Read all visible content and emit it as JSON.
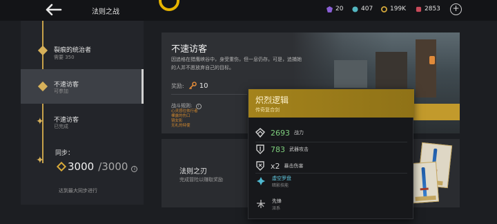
{
  "header": {
    "title": "法则之战",
    "resources": [
      {
        "icon": "purple-gem-icon",
        "value": "20",
        "color": "#8a5fd6"
      },
      {
        "icon": "teal-orb-icon",
        "value": "407",
        "color": "#53b6c0"
      },
      {
        "icon": "gold-coin-icon",
        "value": "199K",
        "color": "#d4a83b"
      },
      {
        "icon": "red-crystal-icon",
        "value": "2853",
        "color": "#c84a5a"
      }
    ]
  },
  "track": {
    "nodes": [
      {
        "title": "裂痕的统治者",
        "sub": "需要 350"
      },
      {
        "title": "不速访客",
        "sub": "可参加"
      },
      {
        "title": "不速访客",
        "sub": "已完成"
      }
    ],
    "sync_label": "同步：",
    "sync_value": "3000",
    "sync_max": "/3000",
    "sync_note": "达到最大同步进行"
  },
  "event": {
    "title": "不速访客",
    "desc": "因追格在猎鹰峡谷中，身受重伤，但一息仍存。可是，追捕她的人并不愿放弃自己的目标。",
    "reward_label": "奖励:",
    "reward_value": "10",
    "rules_label": "战斗规则:",
    "rules": [
      "心灵感往依行者",
      "裸露的伤口",
      "镜女影",
      "无礼的特使"
    ]
  },
  "blade": {
    "title": "法则之刃",
    "sub": "完成冒险以赚取奖励"
  },
  "tooltip": {
    "name": "炽烈逻辑",
    "type": "传奇复合剑",
    "stats": [
      {
        "value": "2693",
        "label": "战力",
        "icon": "power-icon"
      },
      {
        "value": "783",
        "label": "武器攻击",
        "icon": "attack-icon"
      },
      {
        "value": "x2",
        "label": "暴击伤害",
        "icon": "crit-icon"
      }
    ],
    "ability_name": "虚空罗盘",
    "ability_type": "暗影技能",
    "class_name": "先锋",
    "class_type": "派系"
  },
  "colors": {
    "accent_gold": "#c29a2c",
    "stat_green": "#7fd17e",
    "ability_cyan": "#60c9e0",
    "rule_orange": "#d2882e"
  }
}
